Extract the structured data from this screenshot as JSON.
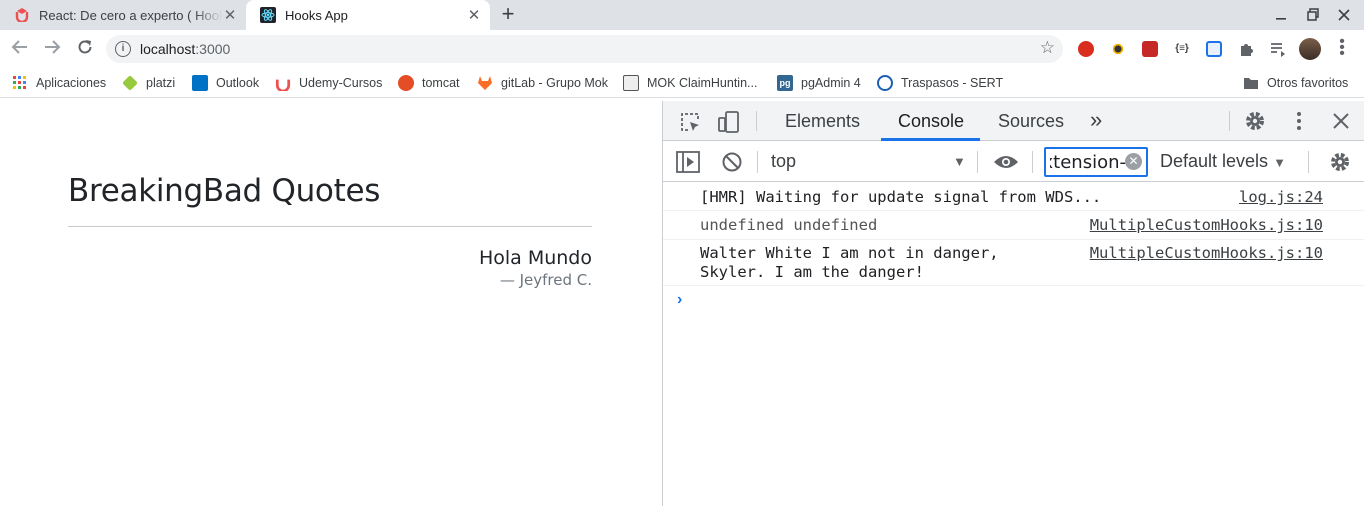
{
  "browser": {
    "tabs": [
      {
        "title": "React: De cero a experto ( Hooks y MERN )",
        "close": "✕"
      },
      {
        "title": "Hooks App",
        "close": "✕"
      }
    ],
    "new_tab": "+",
    "url_host": "localhost",
    "url_port": ":3000",
    "bookmarks": [
      {
        "label": "Aplicaciones",
        "icon": "apps-grid-icon",
        "color": "#e8453c"
      },
      {
        "label": "platzi",
        "icon": "platzi-icon",
        "color": "#98ca3f"
      },
      {
        "label": "Outlook",
        "icon": "outlook-icon",
        "color": "#0072c6"
      },
      {
        "label": "Udemy-Cursos",
        "icon": "udemy-icon",
        "color": "#ec5252"
      },
      {
        "label": "tomcat",
        "icon": "tomcat-icon",
        "color": "#e44d26"
      },
      {
        "label": "gitLab - Grupo Mok",
        "icon": "gitlab-icon",
        "color": "#fc6d26"
      },
      {
        "label": "MOK ClaimHuntin...",
        "icon": "mok-icon",
        "color": "#555555"
      },
      {
        "label": "pgAdmin 4",
        "icon": "pgadmin-icon",
        "color": "#336791"
      },
      {
        "label": "Traspasos - SERT",
        "icon": "sert-icon",
        "color": "#1a5fb4"
      },
      {
        "label": "Otros favoritos",
        "icon": "folder-icon",
        "color": "#5f6368"
      }
    ]
  },
  "page": {
    "title": "BreakingBad Quotes",
    "quote": "Hola Mundo",
    "author": "— Jeyfred C."
  },
  "devtools": {
    "tabs": [
      "Elements",
      "Console",
      "Sources"
    ],
    "more": "»",
    "context": "top",
    "filter_value": "-url:chrome-extension",
    "levels": "Default levels",
    "logs": [
      {
        "message": "[HMR] Waiting for update signal from WDS...",
        "source": "log.js:24"
      },
      {
        "message": "undefined undefined",
        "source": "MultipleCustomHooks.js:10"
      },
      {
        "message": "Walter White I am not in danger,\nSkyler. I am the danger!",
        "source": "MultipleCustomHooks.js:10"
      }
    ],
    "prompt": "›"
  },
  "colors": {
    "accent": "#1a73e8",
    "tabstrip": "#dee1e6"
  }
}
